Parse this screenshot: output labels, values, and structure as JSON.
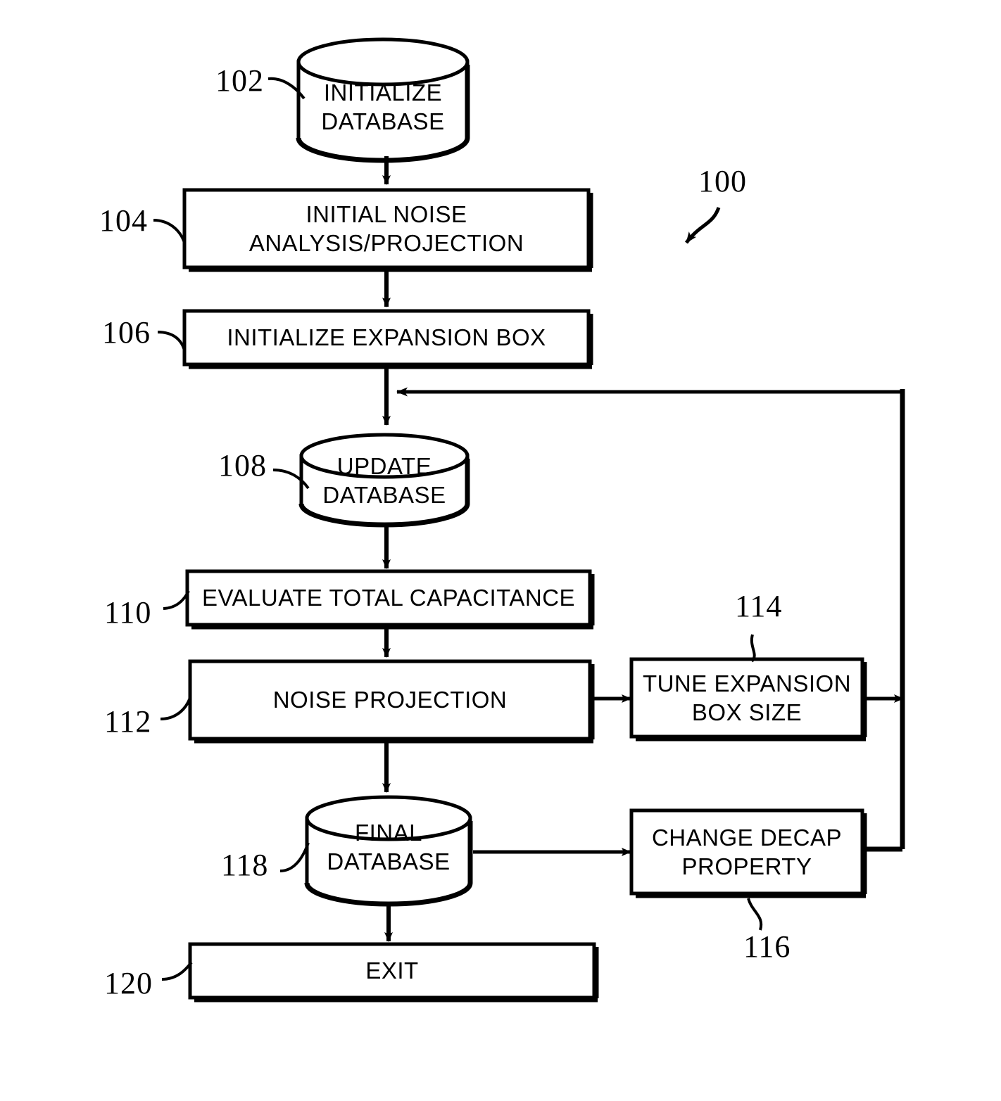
{
  "figure": {
    "id_label": "100",
    "type": "process-flowchart"
  },
  "nodes": [
    {
      "ref": "102",
      "shape": "cylinder",
      "lines": [
        "INITIALIZE",
        "DATABASE"
      ]
    },
    {
      "ref": "104",
      "shape": "rect",
      "lines": [
        "INITIAL NOISE",
        "ANALYSIS/PROJECTION"
      ]
    },
    {
      "ref": "106",
      "shape": "rect",
      "lines": [
        "INITIALIZE EXPANSION BOX"
      ]
    },
    {
      "ref": "108",
      "shape": "cylinder",
      "lines": [
        "UPDATE",
        "DATABASE"
      ]
    },
    {
      "ref": "110",
      "shape": "rect",
      "lines": [
        "EVALUATE TOTAL CAPACITANCE"
      ]
    },
    {
      "ref": "112",
      "shape": "rect",
      "lines": [
        "NOISE PROJECTION"
      ]
    },
    {
      "ref": "114",
      "shape": "rect",
      "lines": [
        "TUNE EXPANSION",
        "BOX SIZE"
      ]
    },
    {
      "ref": "116",
      "shape": "rect",
      "lines": [
        "CHANGE DECAP",
        "PROPERTY"
      ]
    },
    {
      "ref": "118",
      "shape": "cylinder",
      "lines": [
        "FINAL",
        "DATABASE"
      ]
    },
    {
      "ref": "120",
      "shape": "rect",
      "lines": [
        "EXIT"
      ]
    }
  ],
  "colors": {
    "ink": "#000000",
    "paper": "#ffffff"
  }
}
